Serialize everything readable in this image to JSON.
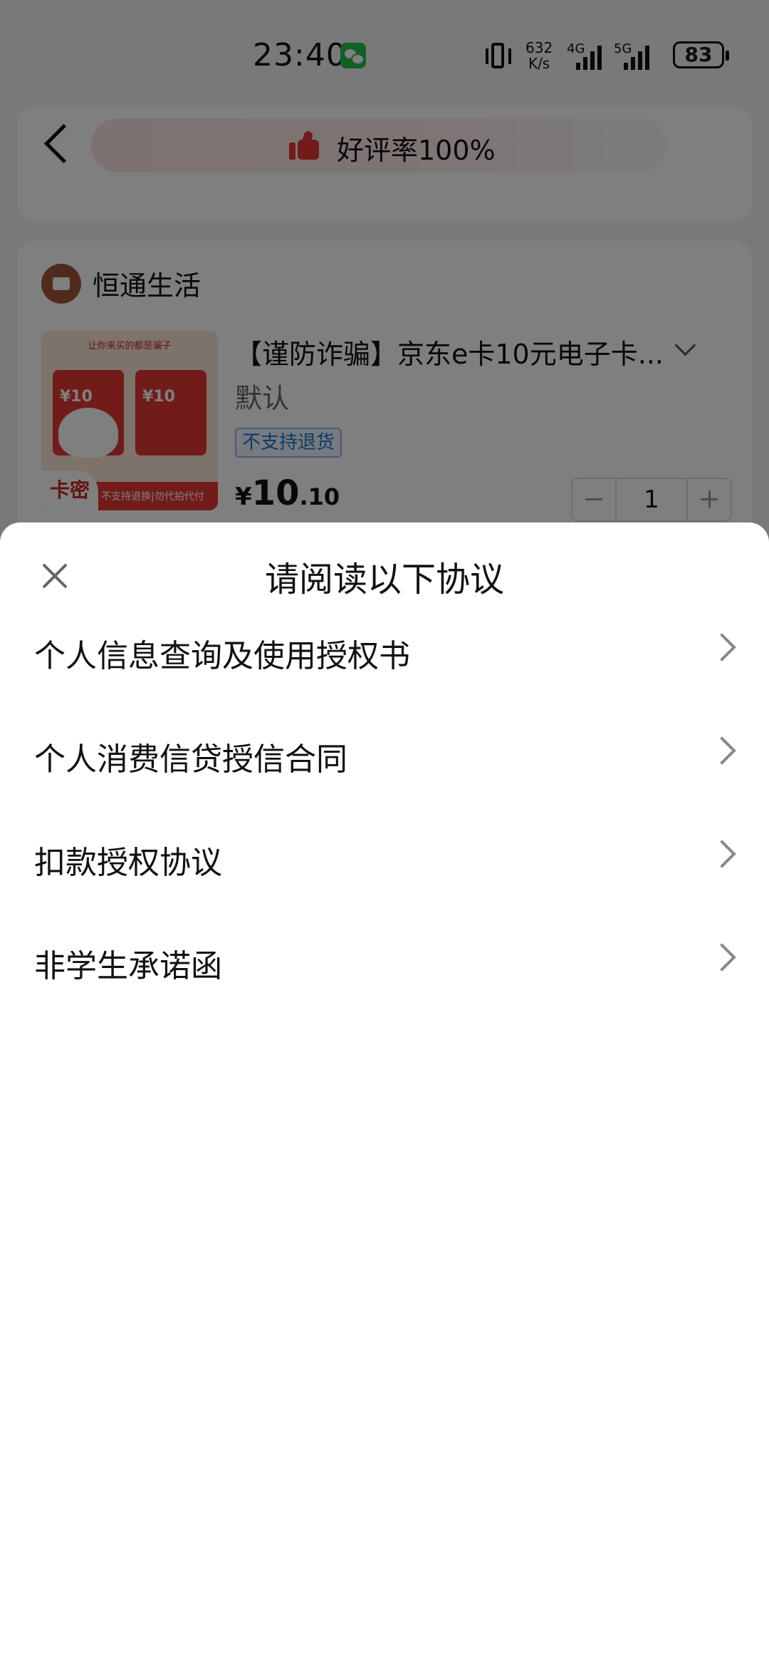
{
  "status_bar": {
    "time": "23:40",
    "net_speed_value": "632",
    "net_speed_unit": "K/s",
    "signal_1": "4G",
    "signal_2": "5G",
    "battery": "83"
  },
  "nav": {
    "rating_text": "好评率100%"
  },
  "shop": {
    "name": "恒通生活",
    "product": {
      "image_header": "让你来买的都是骗子",
      "image_card_1_value": "¥10",
      "image_card_2_value": "¥10",
      "image_badge": "卡密",
      "image_footer": "不支持退换|勿代拍代付",
      "title": "【谨防诈骗】京东e卡10元电子卡...",
      "spec": "默认",
      "return_policy": "不支持退货",
      "price_symbol": "¥",
      "price_integer": "10",
      "price_decimal": ".10",
      "quantity": "1"
    }
  },
  "sheet": {
    "title": "请阅读以下协议",
    "items": [
      {
        "label": "个人信息查询及使用授权书"
      },
      {
        "label": "个人消费信贷授信合同"
      },
      {
        "label": "扣款授权协议"
      },
      {
        "label": "非学生承诺函"
      }
    ]
  },
  "colors": {
    "overlay": "rgba(0,0,0,0.5)",
    "accent_red": "#e53935",
    "badge_blue": "#1976d2",
    "wechat_green": "#22c04b"
  }
}
